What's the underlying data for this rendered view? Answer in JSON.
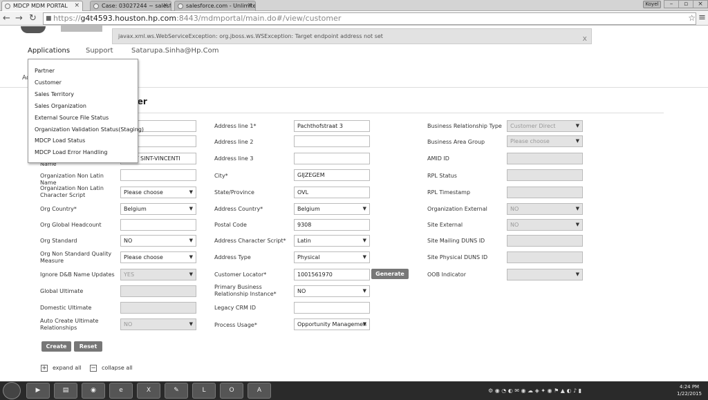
{
  "browser": {
    "tabs": [
      {
        "label": "MDCP MDM PORTAL"
      },
      {
        "label": "Case: 03027244 ~ salesforc"
      },
      {
        "label": "salesforce.com - Unlimite"
      }
    ],
    "user_badge": "Koyel",
    "url_secure": "https://",
    "url_host": "g4t4593.houston.hp.com",
    "url_rest": ":8443/mdmportal/main.do#/view/customer"
  },
  "error": {
    "message": "javax.xml.ws.WebServiceException: org.jboss.ws.WSException: Target endpoint address not set"
  },
  "topnav": {
    "applications": "Applications",
    "support": "Support",
    "user": "Satarupa.Sinha@Hp.Com"
  },
  "subnav": "Ac",
  "section_title": "omer",
  "appmenu": {
    "items": [
      {
        "label": "Partner"
      },
      {
        "label": "Customer"
      },
      {
        "label": "Sales Territory"
      },
      {
        "label": "Sales Organization"
      },
      {
        "label": "External Source File Status"
      },
      {
        "label": "Organization Validation Status(Staging)"
      },
      {
        "label": "MDCP Load Status"
      },
      {
        "label": "MDCP Load Error Handling"
      }
    ]
  },
  "form": {
    "col1": {
      "partial_label": "Name",
      "name_value": "TUUT SINT-VINCENTI",
      "org_non_latin_name": "Organization Non Latin Name",
      "org_non_latin_script": "Organization Non Latin Character Script",
      "org_non_latin_script_value": "Please choose",
      "org_country": "Org Country*",
      "org_country_value": "Belgium",
      "org_global_headcount": "Org Global Headcount",
      "org_standard": "Org Standard",
      "org_standard_value": "NO",
      "org_non_std_quality": "Org Non Standard Quality Measure",
      "org_non_std_quality_value": "Please choose",
      "ignore_dnb": "Ignore D&B Name Updates",
      "ignore_dnb_value": "YES",
      "global_ultimate": "Global Ultimate",
      "domestic_ultimate": "Domestic Ultimate",
      "auto_create": "Auto Create Ultimate Relationships",
      "auto_create_value": "NO"
    },
    "col2": {
      "address1": "Address line 1*",
      "address1_value": "Pachthofstraat 3",
      "address2": "Address line 2",
      "address3": "Address line 3",
      "city": "City*",
      "city_value": "GIJZEGEM",
      "state": "State/Province",
      "state_value": "OVL",
      "address_country": "Address Country*",
      "address_country_value": "Belgium",
      "postal_code": "Postal Code",
      "postal_code_value": "9308",
      "address_script": "Address Character Script*",
      "address_script_value": "Latin",
      "address_type": "Address Type",
      "address_type_value": "Physical",
      "customer_locator": "Customer Locator*",
      "customer_locator_value": "1001561970",
      "generate": "Generate",
      "primary_bri": "Primary Business Relationship Instance*",
      "primary_bri_value": "NO",
      "legacy_crm": "Legacy CRM ID",
      "process_usage": "Process Usage*",
      "process_usage_value": "Opportunity Managemen"
    },
    "col3": {
      "brt": "Business Relationship Type",
      "brt_value": "Customer Direct",
      "bag": "Business Area Group",
      "bag_value": "Please choose",
      "amid": "AMID ID",
      "rpl_status": "RPL Status",
      "rpl_timestamp": "RPL Timestamp",
      "org_external": "Organization External",
      "org_external_value": "NO",
      "site_external": "Site External",
      "site_external_value": "NO",
      "site_mailing_duns": "Site Mailing DUNS ID",
      "site_physical_duns": "Site Physical DUNS ID",
      "oob": "OOB Indicator"
    },
    "create": "Create",
    "reset": "Reset",
    "expand_all": "expand all",
    "collapse_all": "collapse all"
  },
  "taskbar": {
    "time": "4:24 PM",
    "date": "1/22/2015"
  }
}
